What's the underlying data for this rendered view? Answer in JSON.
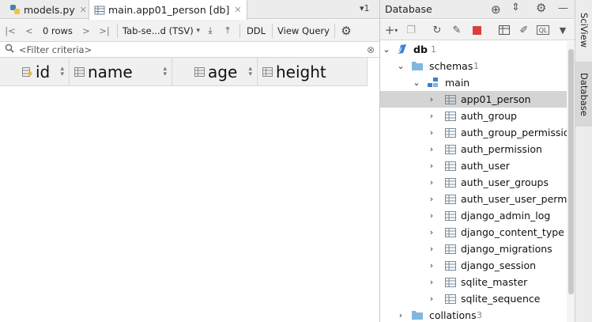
{
  "tabs": [
    {
      "label": "models.py",
      "icon": "python-file-icon",
      "active": false
    },
    {
      "label": "main.app01_person [db]",
      "icon": "table-icon",
      "active": true
    }
  ],
  "tab_menu_label": "▾1",
  "toolbar": {
    "rows_label": "0 rows",
    "format_label": "Tab-se...d (TSV)",
    "ddl_label": "DDL",
    "view_query_label": "View Query"
  },
  "filter": {
    "placeholder": "<Filter criteria>"
  },
  "columns": [
    {
      "label": "id",
      "key": true
    },
    {
      "label": "name",
      "key": false
    },
    {
      "label": "age",
      "key": false
    },
    {
      "label": "height",
      "key": false
    }
  ],
  "database_panel": {
    "title": "Database",
    "tree": [
      {
        "label": "db",
        "count": "1",
        "level": 0,
        "expanded": true,
        "type": "db"
      },
      {
        "label": "schemas",
        "count": "1",
        "level": 1,
        "expanded": true,
        "type": "folder"
      },
      {
        "label": "main",
        "count": "",
        "level": 2,
        "expanded": true,
        "type": "schema"
      },
      {
        "label": "app01_person",
        "level": 3,
        "type": "table",
        "selected": true
      },
      {
        "label": "auth_group",
        "level": 3,
        "type": "table"
      },
      {
        "label": "auth_group_permissions",
        "level": 3,
        "type": "table"
      },
      {
        "label": "auth_permission",
        "level": 3,
        "type": "table"
      },
      {
        "label": "auth_user",
        "level": 3,
        "type": "table"
      },
      {
        "label": "auth_user_groups",
        "level": 3,
        "type": "table"
      },
      {
        "label": "auth_user_user_permissic",
        "level": 3,
        "type": "table"
      },
      {
        "label": "django_admin_log",
        "level": 3,
        "type": "table"
      },
      {
        "label": "django_content_type",
        "level": 3,
        "type": "table"
      },
      {
        "label": "django_migrations",
        "level": 3,
        "type": "table"
      },
      {
        "label": "django_session",
        "level": 3,
        "type": "table"
      },
      {
        "label": "sqlite_master",
        "level": 3,
        "type": "table"
      },
      {
        "label": "sqlite_sequence",
        "level": 3,
        "type": "table"
      },
      {
        "label": "collations",
        "count": "3",
        "level": 1,
        "expanded": false,
        "type": "folder"
      }
    ]
  },
  "side_tabs": [
    {
      "label": "SciView"
    },
    {
      "label": "Database"
    }
  ],
  "colors": {
    "accent_blue": "#3b7fd0",
    "folder_blue": "#7fb7e0",
    "stop_red": "#d9403a",
    "selection": "#d4d4d4"
  }
}
